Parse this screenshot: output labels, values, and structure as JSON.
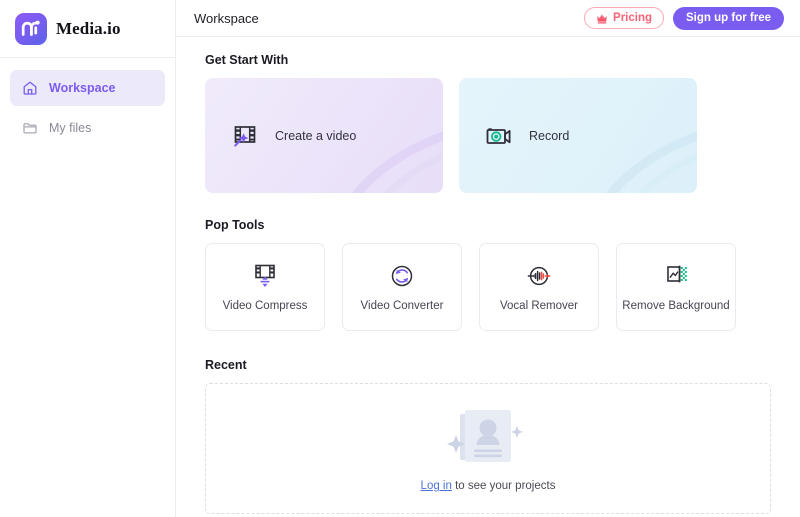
{
  "brand": {
    "name": "Media.io",
    "logo_icon": "media-io-logo-icon",
    "accent": "#7b5cf0"
  },
  "sidebar": {
    "items": [
      {
        "label": "Workspace",
        "icon": "home-icon",
        "active": true
      },
      {
        "label": "My files",
        "icon": "folder-icon",
        "active": false
      }
    ]
  },
  "topbar": {
    "title": "Workspace",
    "pricing_label": "Pricing",
    "pricing_icon": "crown-icon",
    "pricing_color": "#f76275",
    "signup_label": "Sign up for free",
    "signup_color": "#7b5cf0"
  },
  "get_start": {
    "title": "Get Start With",
    "cards": [
      {
        "label": "Create a video",
        "icon": "film-magic-wand-icon",
        "background": "#ece4fa"
      },
      {
        "label": "Record",
        "icon": "video-camera-record-icon",
        "background": "#e0f2fa"
      }
    ]
  },
  "pop_tools": {
    "title": "Pop Tools",
    "tools": [
      {
        "label": "Video Compress",
        "icon": "film-compress-icon"
      },
      {
        "label": "Video Converter",
        "icon": "circular-refresh-icon"
      },
      {
        "label": "Vocal Remover",
        "icon": "waveform-arrows-icon"
      },
      {
        "label": "Remove Background",
        "icon": "image-checkerboard-icon"
      }
    ]
  },
  "recent": {
    "title": "Recent",
    "empty_illustration_icon": "empty-projects-illustration-icon",
    "empty_link_label": "Log in",
    "empty_text": " to see your projects"
  }
}
